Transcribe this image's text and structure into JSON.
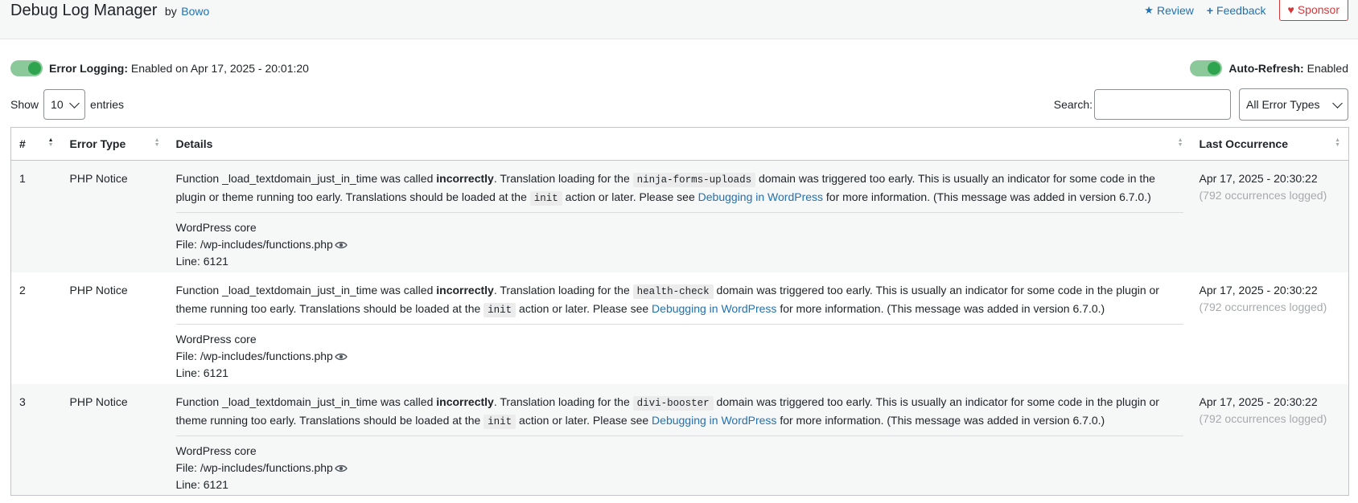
{
  "header": {
    "title": "Debug Log Manager",
    "by": "by",
    "author": "Bowo",
    "review_label": "Review",
    "feedback_label": "Feedback",
    "sponsor_label": "Sponsor"
  },
  "status": {
    "error_logging_label": "Error Logging:",
    "error_logging_value": "Enabled on Apr 17, 2025 - 20:01:20",
    "auto_refresh_label": "Auto-Refresh:",
    "auto_refresh_value": "Enabled"
  },
  "controls": {
    "show_label": "Show",
    "entries_value": "10",
    "entries_label": "entries",
    "search_label": "Search:",
    "search_placeholder": "",
    "filter_value": "All Error Types"
  },
  "table": {
    "columns": [
      "#",
      "Error Type",
      "Details",
      "Last Occurrence"
    ],
    "rows": [
      {
        "num": "1",
        "type": "PHP Notice",
        "msg_a": "Function _load_textdomain_just_in_time was called ",
        "msg_bold": "incorrectly",
        "msg_b": ". Translation loading for the ",
        "domain": "ninja-forms-uploads",
        "msg_c": " domain was triggered too early. This is usually an indicator for some code in the plugin or theme running too early. Translations should be loaded at the ",
        "action": "init",
        "msg_d": " action or later. Please see ",
        "link": "Debugging in WordPress",
        "msg_e": " for more information. (This message was added in version 6.7.0.)",
        "source": "WordPress core",
        "file": "File: /wp-includes/functions.php",
        "line": "Line: 6121",
        "last": "Apr 17, 2025 - 20:30:22",
        "count": "(792 occurrences logged)"
      },
      {
        "num": "2",
        "type": "PHP Notice",
        "msg_a": "Function _load_textdomain_just_in_time was called ",
        "msg_bold": "incorrectly",
        "msg_b": ". Translation loading for the ",
        "domain": "health-check",
        "msg_c": " domain was triggered too early. This is usually an indicator for some code in the plugin or theme running too early. Translations should be loaded at the ",
        "action": "init",
        "msg_d": " action or later. Please see ",
        "link": "Debugging in WordPress",
        "msg_e": " for more information. (This message was added in version 6.7.0.)",
        "source": "WordPress core",
        "file": "File: /wp-includes/functions.php",
        "line": "Line: 6121",
        "last": "Apr 17, 2025 - 20:30:22",
        "count": "(792 occurrences logged)"
      },
      {
        "num": "3",
        "type": "PHP Notice",
        "msg_a": "Function _load_textdomain_just_in_time was called ",
        "msg_bold": "incorrectly",
        "msg_b": ". Translation loading for the ",
        "domain": "divi-booster",
        "msg_c": " domain was triggered too early. This is usually an indicator for some code in the plugin or theme running too early. Translations should be loaded at the ",
        "action": "init",
        "msg_d": " action or later. Please see ",
        "link": "Debugging in WordPress",
        "msg_e": " for more information. (This message was added in version 6.7.0.)",
        "source": "WordPress core",
        "file": "File: /wp-includes/functions.php",
        "line": "Line: 6121",
        "last": "Apr 17, 2025 - 20:30:22",
        "count": "(792 occurrences logged)"
      }
    ]
  },
  "icons": {
    "review": "star-icon",
    "feedback": "plus-icon",
    "sponsor": "heart-icon",
    "file": "eye-icon"
  },
  "colors": {
    "link": "#2271b1",
    "sponsor": "#d63638",
    "toggle": "#2ea44f"
  }
}
